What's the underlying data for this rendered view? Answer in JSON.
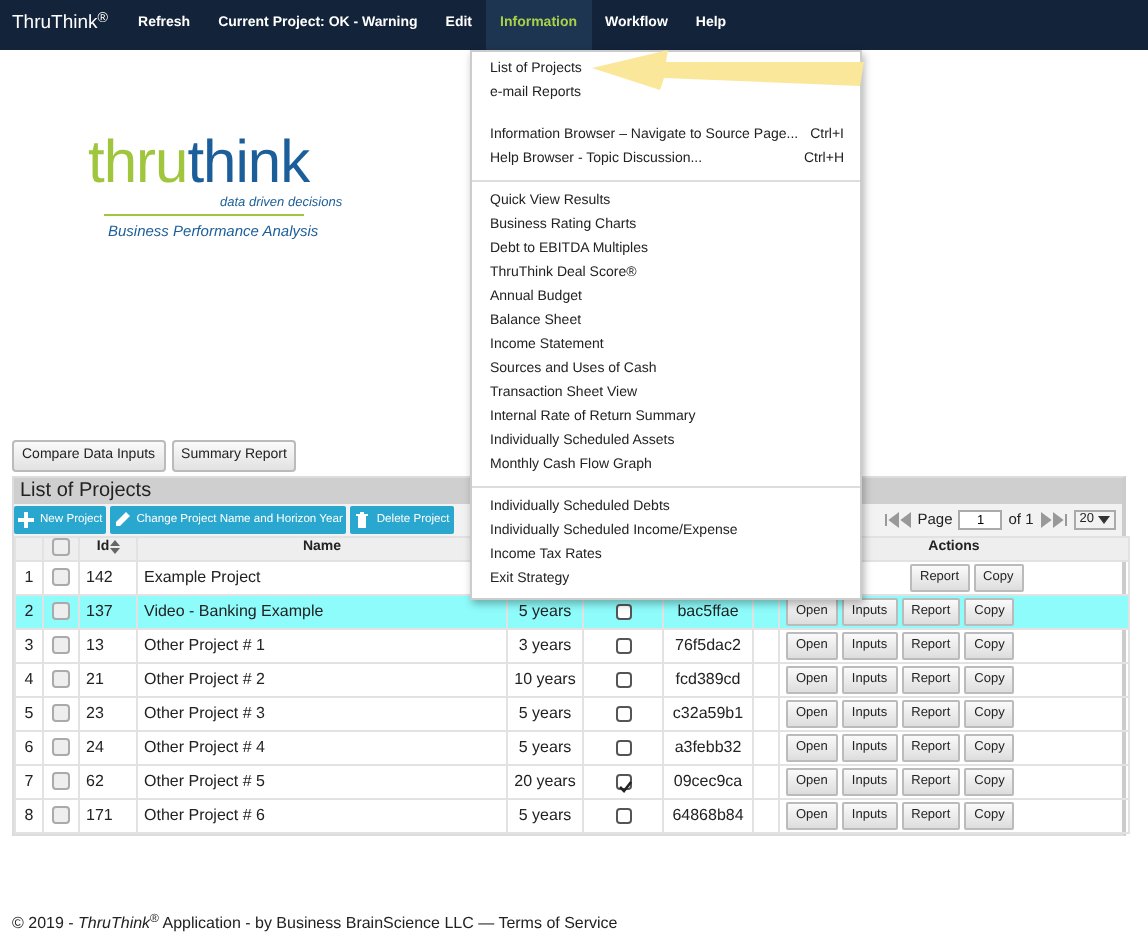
{
  "navbar": {
    "brand": "ThruThink$^{®}$",
    "items": [
      {
        "label": "Refresh",
        "selected": false
      },
      {
        "label": "Current Project: OK - Warning",
        "selected": false
      },
      {
        "label": "Edit",
        "selected": false
      },
      {
        "label": "Information",
        "selected": true
      },
      {
        "label": "Workflow",
        "selected": false
      },
      {
        "label": "Help",
        "selected": false
      }
    ]
  },
  "logo": {
    "word_1": "thru",
    "word_2": "think",
    "tagline": "data driven decisions",
    "subtitle": "Business Performance Analysis"
  },
  "top_buttons": [
    "Compare Data Inputs",
    "Summary Report"
  ],
  "grid": {
    "title": "List of Projects",
    "all_selected": false,
    "toolbar": [
      {
        "label": "New Project"
      },
      {
        "label": "Change Project Name and Horizon Year"
      },
      {
        "label": "Delete Project"
      }
    ],
    "pager": {
      "page_label": "Page",
      "page": "1",
      "of": "of 1",
      "page_size": "20"
    },
    "columns": [
      "Id",
      "Name",
      "Actions"
    ],
    "rows": [
      {
        "num": "1",
        "selected_box": false,
        "id": "142",
        "name": "Example Project",
        "selected": false,
        "actions": [
          "Report",
          "Copy"
        ]
      },
      {
        "num": "2",
        "selected_box": false,
        "id": "137",
        "name": "Video - Banking Example",
        "horizon": "5 years",
        "flag": false,
        "hash": "bac5ffae",
        "selected": true,
        "actions": [
          "Open",
          "Inputs",
          "Report",
          "Copy"
        ]
      },
      {
        "num": "3",
        "selected_box": false,
        "id": "13",
        "name": "Other Project # 1",
        "horizon": "3 years",
        "flag": false,
        "hash": "76f5dac2",
        "selected": false,
        "actions": [
          "Open",
          "Inputs",
          "Report",
          "Copy"
        ]
      },
      {
        "num": "4",
        "selected_box": false,
        "id": "21",
        "name": "Other Project # 2",
        "horizon": "10 years",
        "flag": false,
        "hash": "fcd389cd",
        "selected": false,
        "actions": [
          "Open",
          "Inputs",
          "Report",
          "Copy"
        ]
      },
      {
        "num": "5",
        "selected_box": false,
        "id": "23",
        "name": "Other Project # 3",
        "horizon": "5 years",
        "flag": false,
        "hash": "c32a59b1",
        "selected": false,
        "actions": [
          "Open",
          "Inputs",
          "Report",
          "Copy"
        ]
      },
      {
        "num": "6",
        "selected_box": false,
        "id": "24",
        "name": "Other Project # 4",
        "horizon": "5 years",
        "flag": false,
        "hash": "a3febb32",
        "selected": false,
        "actions": [
          "Open",
          "Inputs",
          "Report",
          "Copy"
        ]
      },
      {
        "num": "7",
        "selected_box": false,
        "id": "62",
        "name": "Other Project # 5",
        "horizon": "20 years",
        "flag": true,
        "hash": "09cec9ca",
        "selected": false,
        "actions": [
          "Open",
          "Inputs",
          "Report",
          "Copy"
        ]
      },
      {
        "num": "8",
        "selected_box": false,
        "id": "171",
        "name": "Other Project # 6",
        "horizon": "5 years",
        "flag": false,
        "hash": "64868b84",
        "selected": false,
        "actions": [
          "Open",
          "Inputs",
          "Report",
          "Copy"
        ]
      }
    ]
  },
  "menu": {
    "sections": [
      {
        "blocks": [
          [
            {
              "label": "List of Projects"
            },
            {
              "label": "e-mail Reports"
            }
          ],
          [
            {
              "label": "Information Browser – Navigate to Source Page...",
              "shortcut": "Ctrl+I"
            },
            {
              "label": "Help Browser - Topic Discussion...",
              "shortcut": "Ctrl+H"
            }
          ]
        ]
      },
      {
        "blocks": [
          [
            {
              "label": "Quick View Results"
            },
            {
              "label": "Business Rating Charts"
            },
            {
              "label": "Debt to EBITDA Multiples"
            },
            {
              "label": "ThruThink Deal Score®"
            },
            {
              "label": "Annual Budget"
            },
            {
              "label": "Balance Sheet"
            },
            {
              "label": "Income Statement"
            },
            {
              "label": "Sources and Uses of Cash"
            },
            {
              "label": "Transaction Sheet View"
            },
            {
              "label": "Internal Rate of Return Summary"
            },
            {
              "label": "Individually Scheduled Assets"
            },
            {
              "label": "Monthly Cash Flow Graph"
            }
          ]
        ]
      },
      {
        "blocks": [
          [
            {
              "label": "Individually Scheduled Debts"
            },
            {
              "label": "Individually Scheduled Income/Expense"
            },
            {
              "label": "Income Tax Rates"
            },
            {
              "label": "Exit Strategy"
            }
          ]
        ]
      }
    ]
  },
  "footer": {
    "text": "© 2019 - *ThruThink*$^{®}$ Application - by Business BrainScience LLC —",
    "link": "Terms of Service"
  }
}
